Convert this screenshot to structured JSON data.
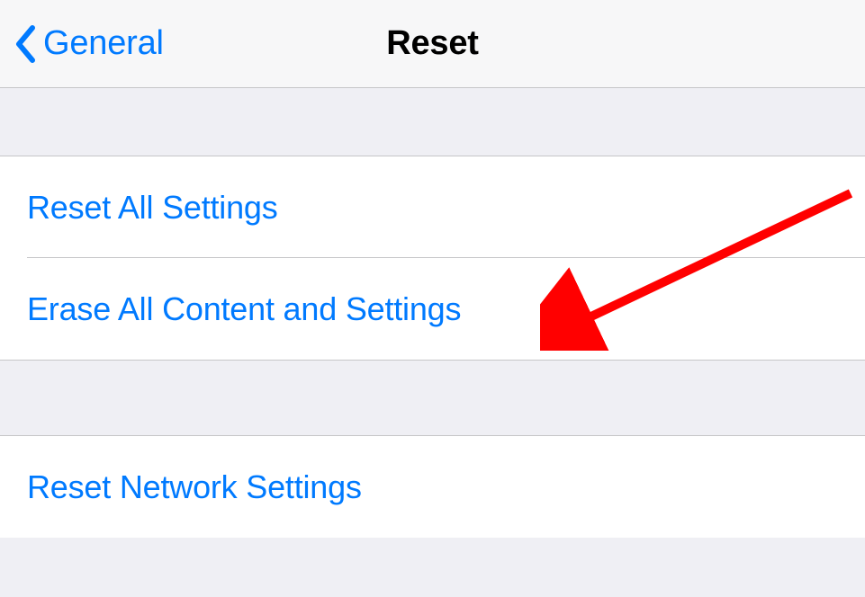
{
  "nav": {
    "backLabel": "General",
    "title": "Reset"
  },
  "groups": [
    {
      "items": [
        {
          "label": "Reset All Settings"
        },
        {
          "label": "Erase All Content and Settings"
        }
      ]
    },
    {
      "items": [
        {
          "label": "Reset Network Settings"
        }
      ]
    }
  ],
  "colors": {
    "link": "#007aff",
    "groupBg": "#efeff4",
    "separator": "#c6c6c8",
    "annotation": "#ff0000"
  }
}
